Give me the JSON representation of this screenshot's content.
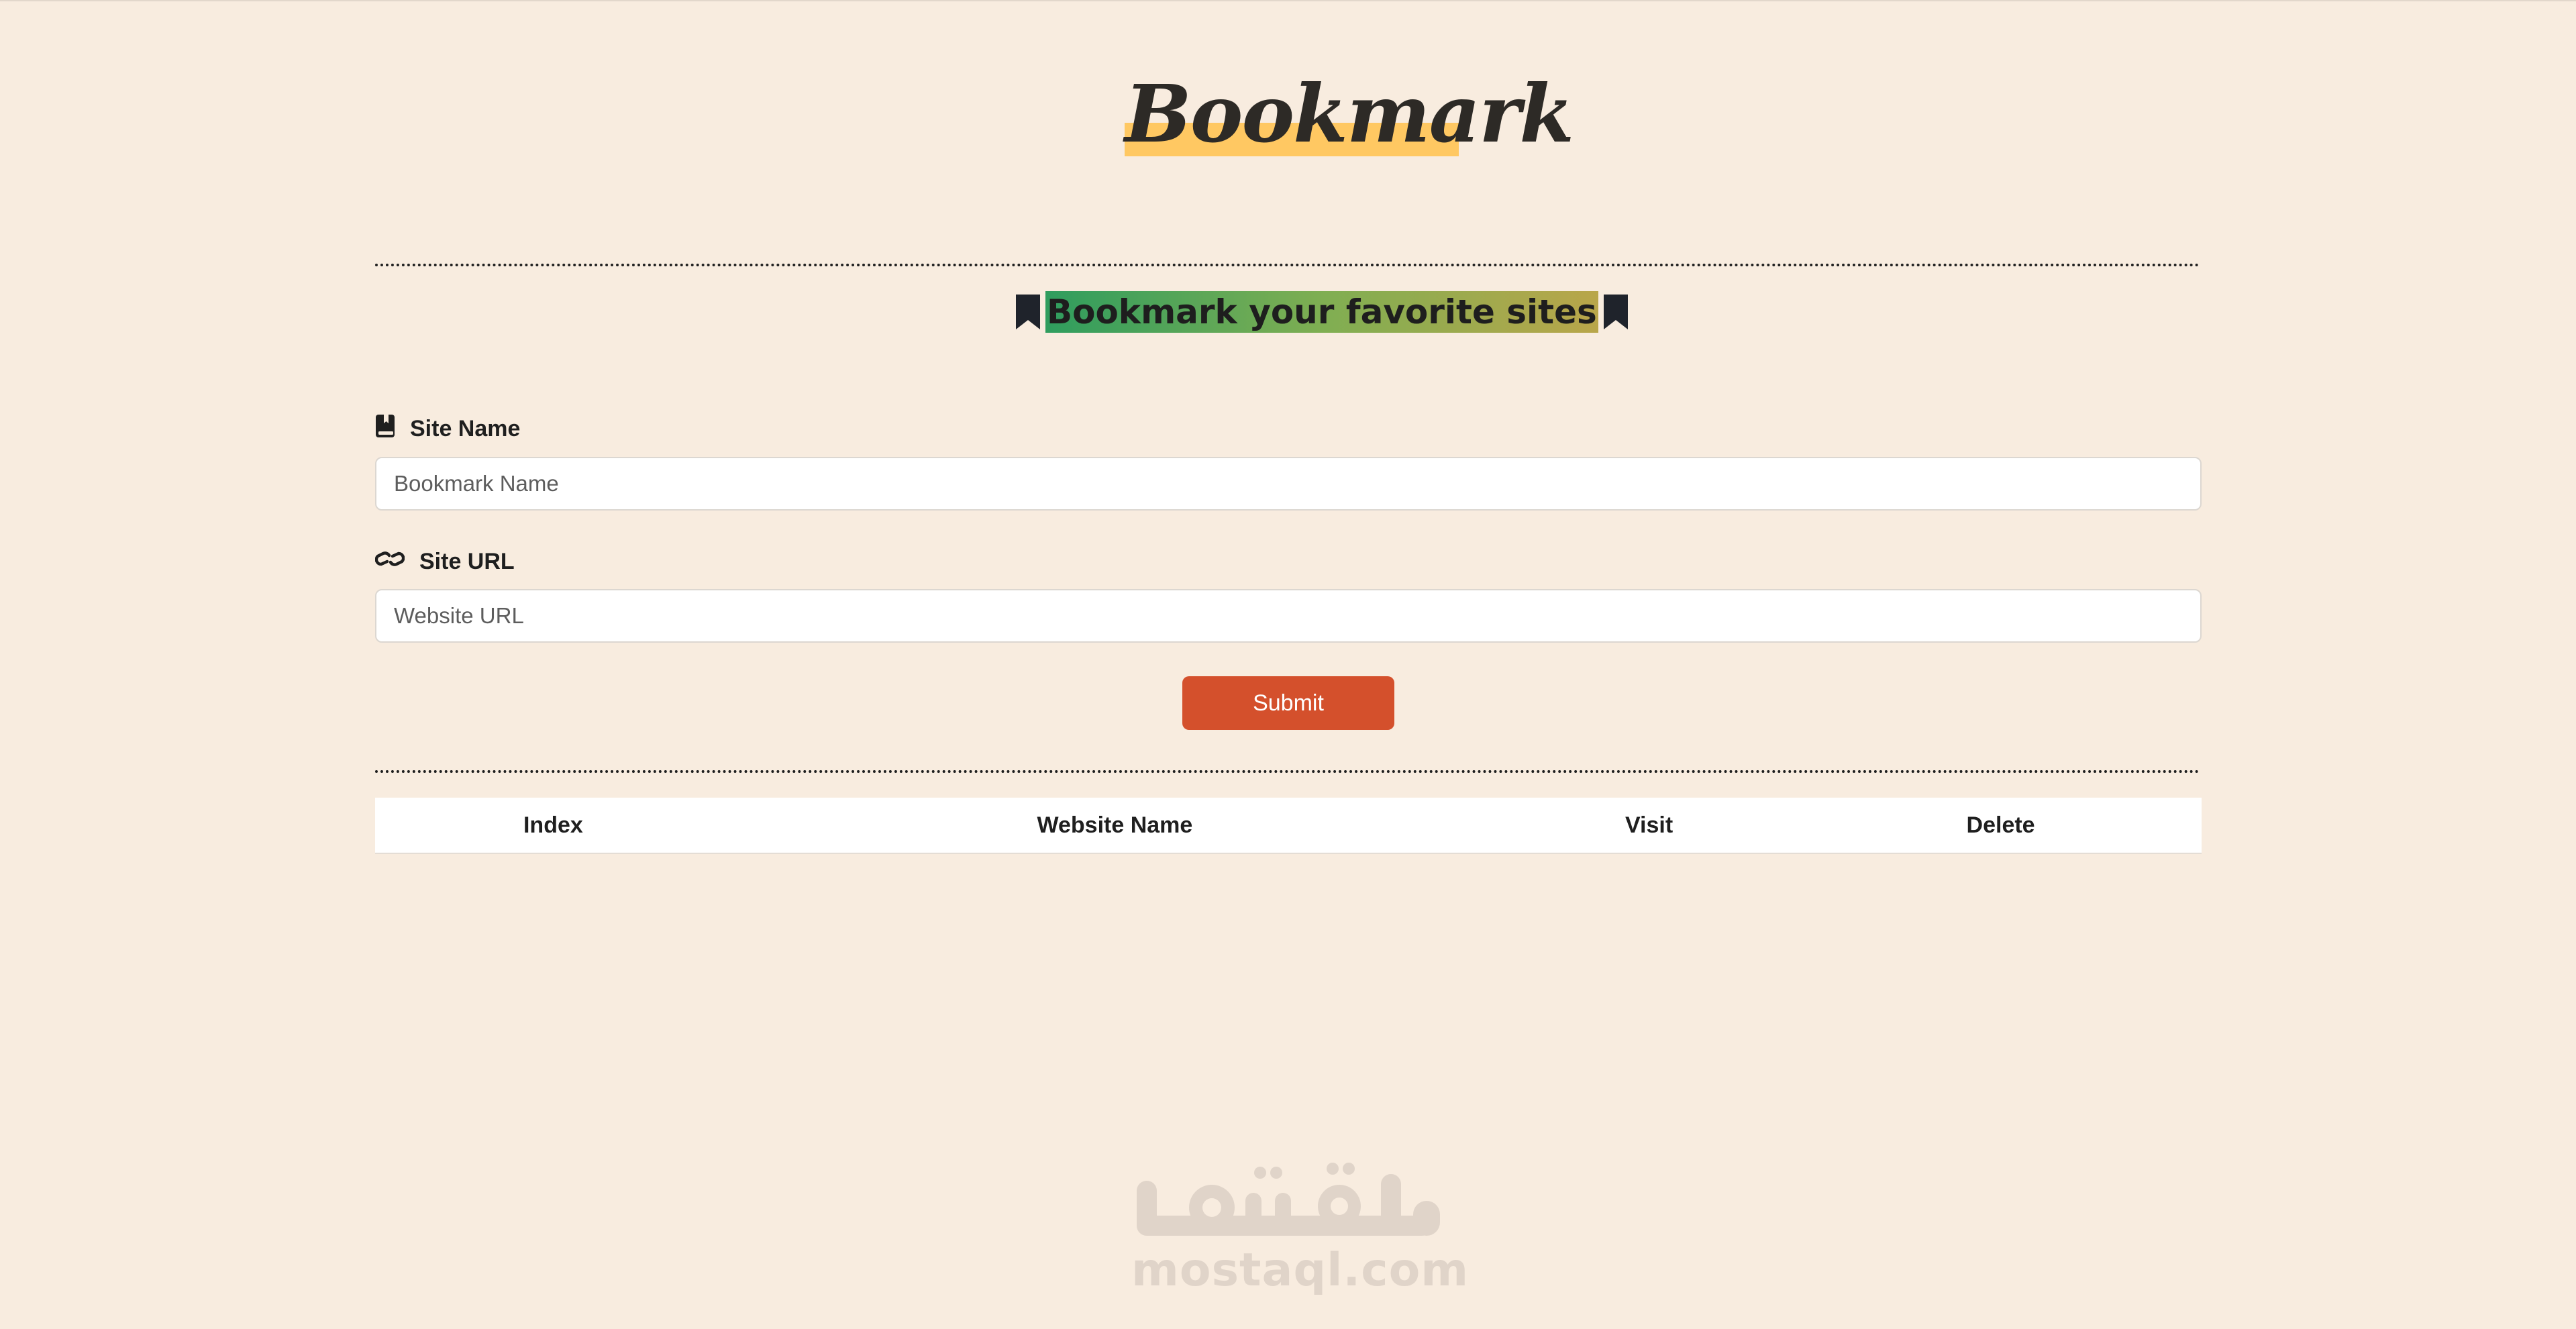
{
  "app": {
    "logo": "Bookmark",
    "subtitle": "Bookmark your favorite sites",
    "colors": {
      "background": "#f8ecdf",
      "logo_highlight": "#ffc862",
      "subtitle_gradient_start": "#2f9d5e",
      "subtitle_gradient_end": "#b9a64a",
      "submit_button": "#d4502c"
    }
  },
  "form": {
    "site_name": {
      "label": "Site Name",
      "icon": "book-bookmark-icon",
      "placeholder": "Bookmark Name",
      "value": ""
    },
    "site_url": {
      "label": "Site URL",
      "icon": "link-icon",
      "placeholder": "Website URL",
      "value": ""
    },
    "submit_label": "Submit"
  },
  "table": {
    "columns": [
      "Index",
      "Website Name",
      "Visit",
      "Delete"
    ],
    "rows": []
  },
  "watermark": {
    "arabic": "مستقل",
    "latin": "mostaql.com"
  }
}
